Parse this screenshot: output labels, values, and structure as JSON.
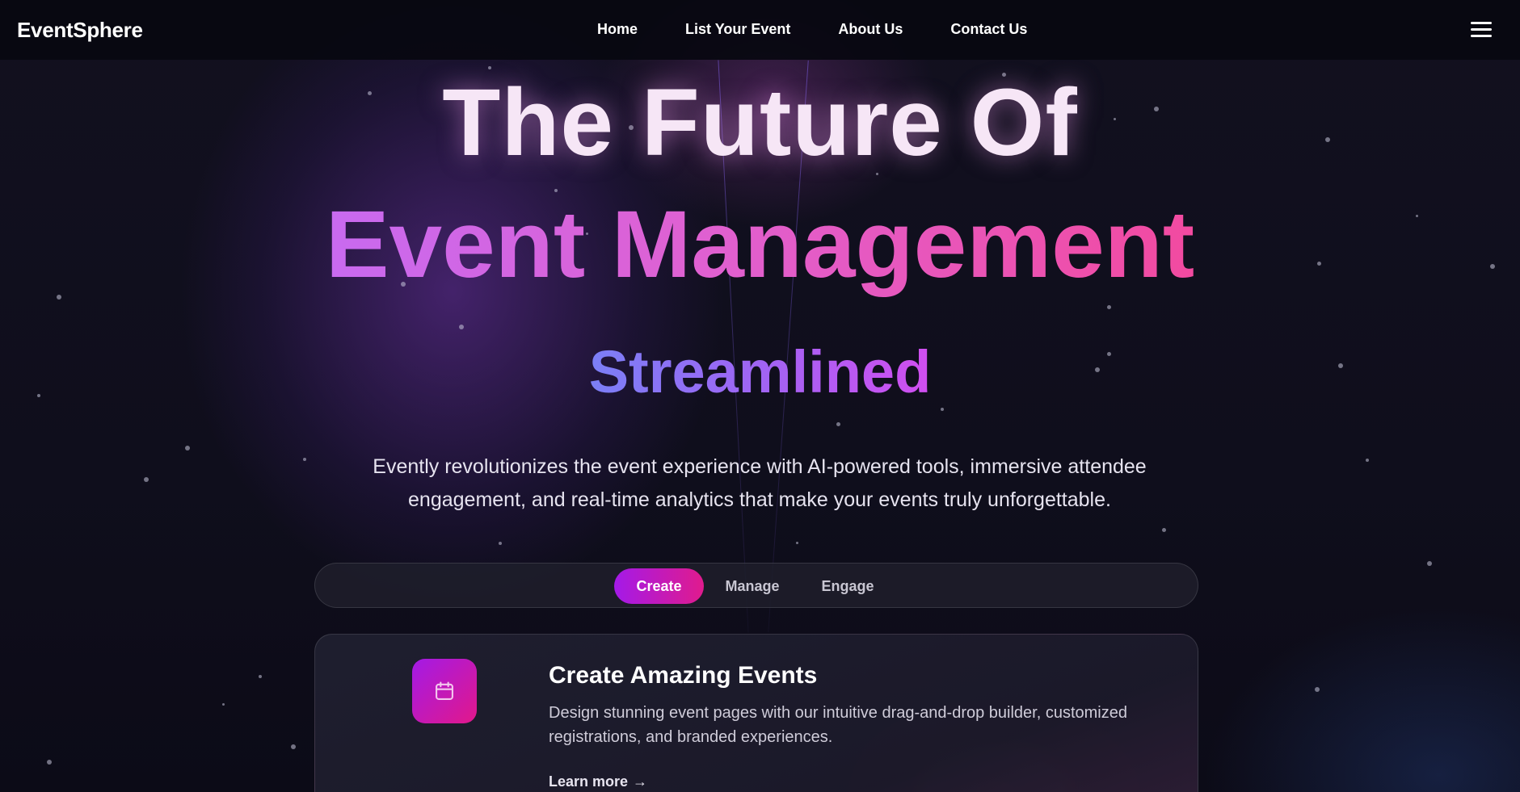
{
  "nav": {
    "brand": "EventSphere",
    "links": [
      "Home",
      "List Your Event",
      "About Us",
      "Contact Us"
    ],
    "menu_icon": "hamburger-menu-icon"
  },
  "hero": {
    "line1": "The Future Of",
    "line2": "Event Management",
    "line3": "Streamlined",
    "subtitle": "Evently revolutionizes the event experience with AI-powered tools, immersive attendee engagement, and real-time analytics that make your events truly unforgettable."
  },
  "tabs": {
    "items": [
      "Create",
      "Manage",
      "Engage"
    ],
    "active": "Create"
  },
  "feature": {
    "icon": "calendar-icon",
    "title": "Create Amazing Events",
    "text": "Design stunning event pages with our intuitive drag-and-drop builder, customized registrations, and branded experiences.",
    "link": "Learn more",
    "link_arrow": "→"
  },
  "colors": {
    "background": "#0d0c1a",
    "accent_purple": "#a41ae8",
    "accent_pink": "#e01b8d",
    "heading_gradient_start": "#c86af0",
    "heading_gradient_end": "#f24aa0"
  }
}
